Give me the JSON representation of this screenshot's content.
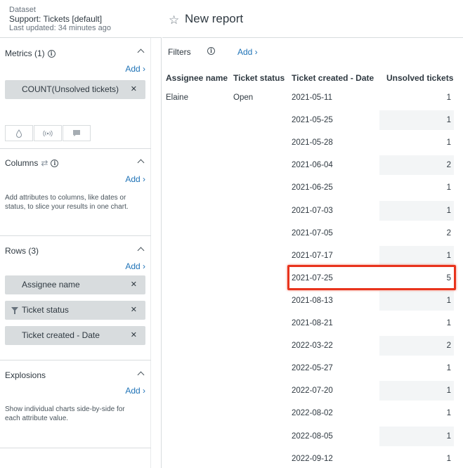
{
  "dataset": {
    "label": "Dataset",
    "name": "Support: Tickets [default]",
    "updated": "Last updated: 34 minutes ago"
  },
  "metrics": {
    "title": "Metrics (1)",
    "add_label": "Add ›",
    "items": [
      "COUNT(Unsolved tickets)"
    ],
    "chart_type_icons": [
      "drop-icon",
      "broadcast-icon",
      "speech-bubble-icon"
    ]
  },
  "columns": {
    "title": "Columns",
    "add_label": "Add ›",
    "help": "Add attributes to columns, like dates or status, to slice your results in one chart."
  },
  "rows": {
    "title": "Rows (3)",
    "add_label": "Add ›",
    "items": [
      "Assignee name",
      "Ticket status",
      "Ticket created - Date"
    ]
  },
  "explosions": {
    "title": "Explosions",
    "add_label": "Add ›",
    "help": "Show individual charts side-by-side for each attribute value."
  },
  "report": {
    "title": "New report"
  },
  "filters": {
    "label": "Filters",
    "add_label": "Add ›"
  },
  "table": {
    "headers": [
      "Assignee name",
      "Ticket status",
      "Ticket created - Date",
      "Unsolved tickets"
    ],
    "assignee": "Elaine",
    "status": "Open",
    "rows": [
      {
        "date": "2021-05-11",
        "count": "1"
      },
      {
        "date": "2021-05-25",
        "count": "1"
      },
      {
        "date": "2021-05-28",
        "count": "1"
      },
      {
        "date": "2021-06-04",
        "count": "2"
      },
      {
        "date": "2021-06-25",
        "count": "1"
      },
      {
        "date": "2021-07-03",
        "count": "1"
      },
      {
        "date": "2021-07-05",
        "count": "2"
      },
      {
        "date": "2021-07-17",
        "count": "1"
      },
      {
        "date": "2021-07-25",
        "count": "5"
      },
      {
        "date": "2021-08-13",
        "count": "1"
      },
      {
        "date": "2021-08-21",
        "count": "1"
      },
      {
        "date": "2022-03-22",
        "count": "2"
      },
      {
        "date": "2022-05-27",
        "count": "1"
      },
      {
        "date": "2022-07-20",
        "count": "1"
      },
      {
        "date": "2022-08-02",
        "count": "1"
      },
      {
        "date": "2022-08-05",
        "count": "1"
      },
      {
        "date": "2022-09-12",
        "count": "1"
      }
    ],
    "highlighted_row_index": 8
  },
  "colors": {
    "link": "#1f73b7",
    "pill": "#d8dcde",
    "highlight": "#e8331c",
    "stripe": "#f3f5f6"
  }
}
